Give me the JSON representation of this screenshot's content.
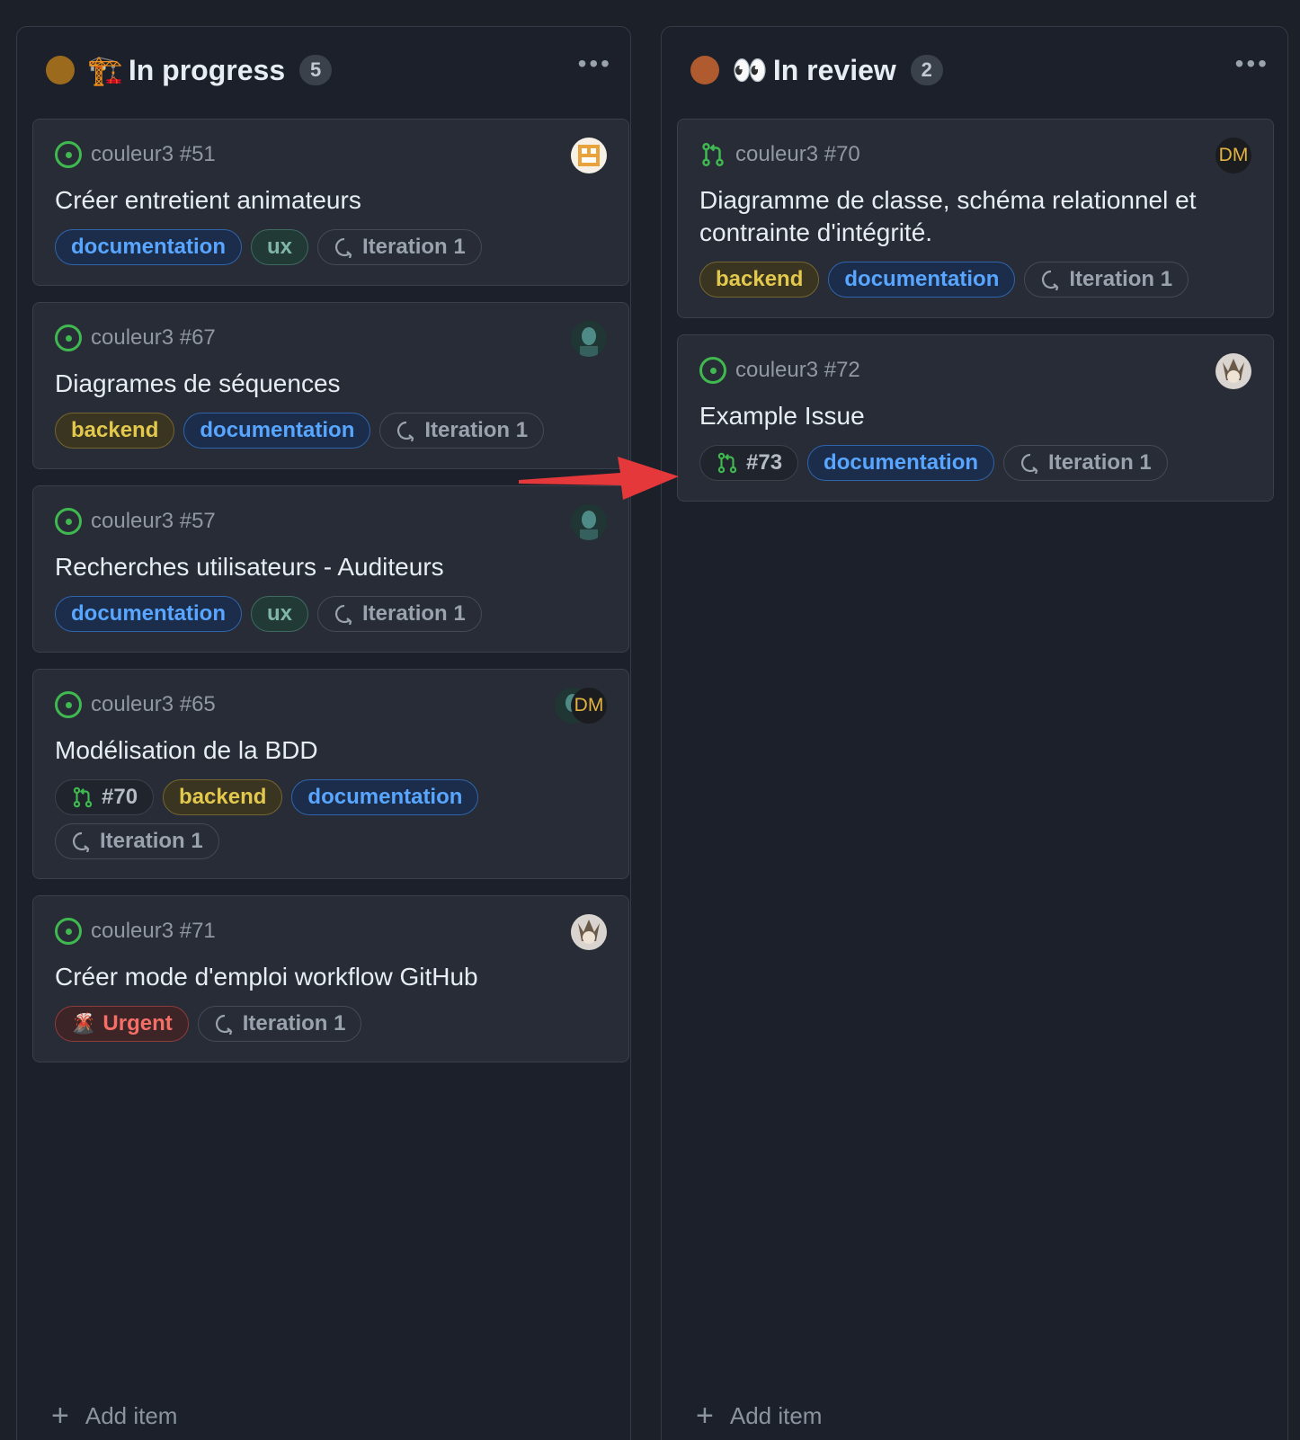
{
  "columns": [
    {
      "title": "In progress",
      "emoji": "🏗️",
      "count": "5",
      "dot_color": "#9b6a1d",
      "menu": "•••",
      "add_item": "Add item",
      "cards": [
        {
          "repo": "couleur3 #51",
          "title": "Créer entretient animateurs",
          "labels": [
            "documentation",
            "ux",
            "Iteration 1"
          ]
        },
        {
          "repo": "couleur3 #67",
          "title": "Diagrames de séquences",
          "labels": [
            "backend",
            "documentation",
            "Iteration 1"
          ]
        },
        {
          "repo": "couleur3 #57",
          "title": "Recherches utilisateurs - Auditeurs",
          "labels": [
            "documentation",
            "ux",
            "Iteration 1"
          ]
        },
        {
          "repo": "couleur3 #65",
          "title": "Modélisation de la BDD",
          "labels": [
            "#70",
            "backend",
            "documentation",
            "Iteration 1"
          ],
          "avatar_text": "DM"
        },
        {
          "repo": "couleur3 #71",
          "title": "Créer mode d'emploi workflow GitHub",
          "labels": [
            "Urgent",
            "Iteration 1"
          ],
          "urgent_emoji": "🌋"
        }
      ]
    },
    {
      "title": "In review",
      "emoji": "👀",
      "count": "2",
      "dot_color": "#b05a2f",
      "menu": "•••",
      "add_item": "Add item",
      "cards": [
        {
          "repo": "couleur3 #70",
          "title": "Diagramme de classe, schéma relationnel et contrainte d'intégrité.",
          "labels": [
            "backend",
            "documentation",
            "Iteration 1"
          ],
          "avatar_text": "DM"
        },
        {
          "repo": "couleur3 #72",
          "title": "Example Issue",
          "labels": [
            "#73",
            "documentation",
            "Iteration 1"
          ]
        }
      ]
    }
  ],
  "colors": {
    "background": "#1c2028",
    "card": "#272c36",
    "open_issue": "#3fb950",
    "arrow": "#e5383b"
  },
  "icons": {
    "issue": "issue-opened-icon",
    "pull_request": "git-pull-request-icon",
    "iteration": "iteration-icon"
  }
}
